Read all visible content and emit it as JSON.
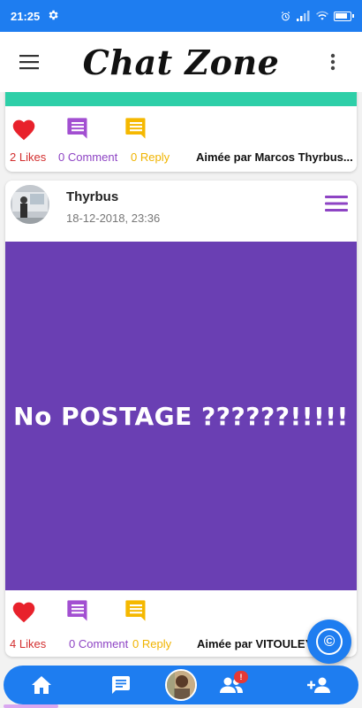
{
  "status_bar": {
    "time": "21:25"
  },
  "app_bar": {
    "title": "Chat Zone"
  },
  "posts": [
    {
      "likes": "2 Likes",
      "comments": "0 Comment",
      "replies": "0 Reply",
      "liked_by": "Aimée par Marcos Thyrbus..."
    },
    {
      "author": "Thyrbus",
      "timestamp": "18-12-2018, 23:36",
      "text": "No POSTAGE ??????!!!!!",
      "likes": "4 Likes",
      "comments": "0 Comment",
      "replies": "0 Reply",
      "liked_by": "Aimée par VITOULEY"
    }
  ],
  "fab": {
    "symbol": "©"
  },
  "bottom_nav": {
    "friends_badge": "!"
  },
  "colors": {
    "primary": "#1e7df0",
    "teal": "#2ecfa8",
    "post_bg": "#6a3fb3",
    "like": "#d32f2f",
    "comment": "#8e44c4",
    "reply": "#f0b400"
  },
  "icons": [
    "settings-icon",
    "alarm-icon",
    "signal-icon",
    "wifi-icon",
    "battery-icon",
    "menu-icon",
    "more-vert-icon",
    "heart-icon",
    "comment-icon",
    "reply-icon",
    "hamburger-icon",
    "copyright-icon",
    "home-icon",
    "chat-icon",
    "people-icon",
    "add-friend-icon"
  ]
}
